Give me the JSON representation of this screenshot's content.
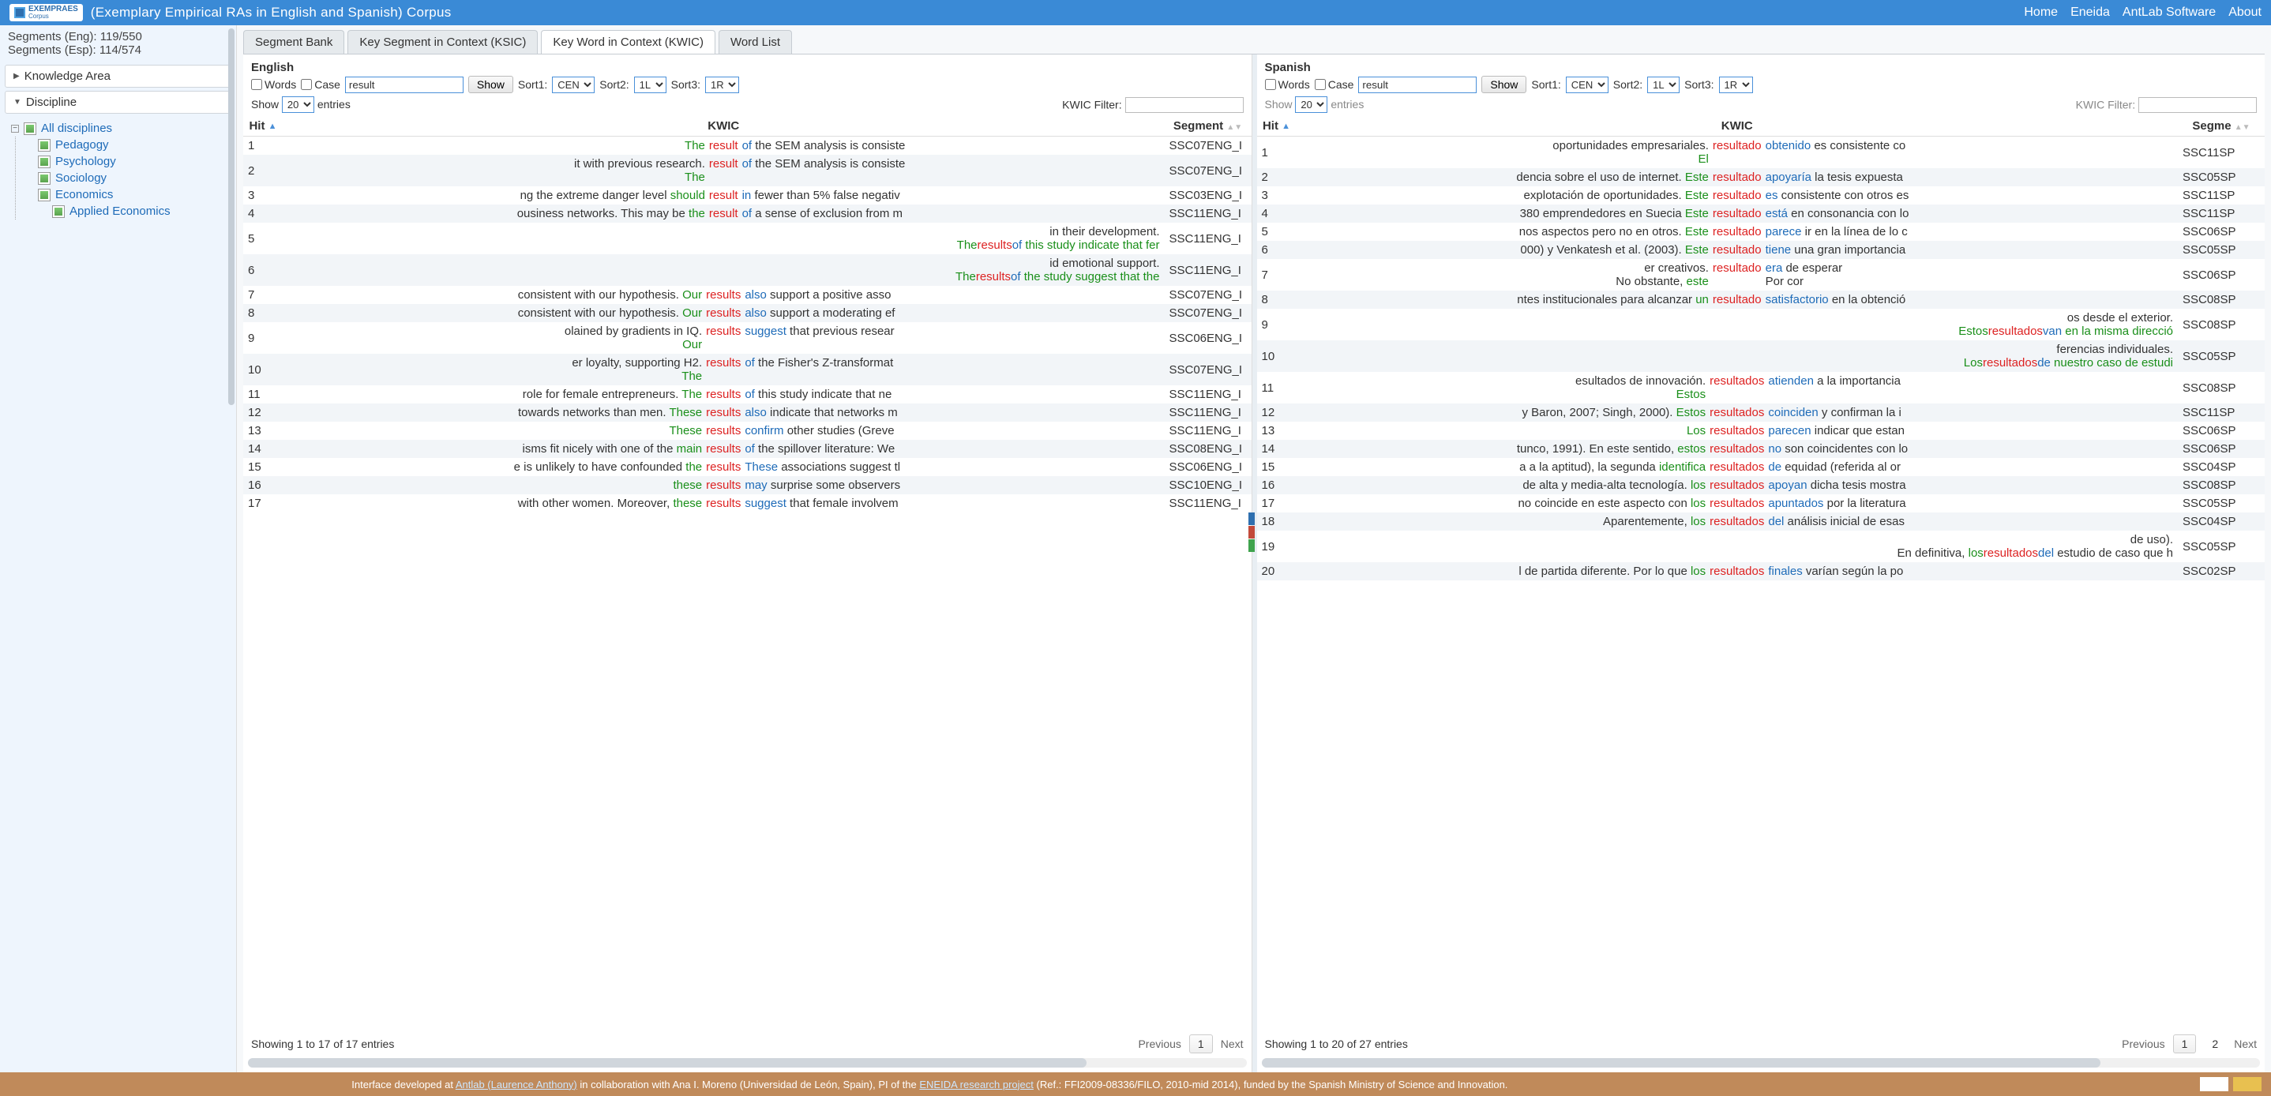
{
  "header": {
    "logo_text_top": "EXEMPRAES",
    "logo_text_bottom": "Corpus",
    "title": "(Exemplary Empirical RAs in English and Spanish) Corpus",
    "nav": {
      "home": "Home",
      "eneida": "Eneida",
      "antlab": "AntLab Software",
      "about": "About"
    }
  },
  "sidebar": {
    "seg_eng": "Segments (Eng): 119/550",
    "seg_esp": "Segments (Esp): 114/574",
    "knowledge_area": "Knowledge Area",
    "discipline": "Discipline",
    "all_disciplines": "All disciplines",
    "items": [
      "Pedagogy",
      "Psychology",
      "Sociology",
      "Economics",
      "Applied Economics"
    ]
  },
  "tabs": {
    "seg_bank": "Segment Bank",
    "ksic": "Key Segment in Context (KSIC)",
    "kwic": "Key Word in Context (KWIC)",
    "word_list": "Word List"
  },
  "controls": {
    "words": "Words",
    "case": "Case",
    "show_btn": "Show",
    "sort1": "Sort1:",
    "sort2": "Sort2:",
    "sort3": "Sort3:",
    "sort1_val": "CEN",
    "sort2_val": "1L",
    "sort3_val": "1R",
    "show_label": "Show",
    "entries": "entries",
    "kwic_filter": "KWIC Filter:",
    "entries_sel": "20"
  },
  "eng": {
    "title": "English",
    "search": "result",
    "cols": {
      "hit": "Hit",
      "kwic": "KWIC",
      "segment": "Segment"
    },
    "info": "Showing 1 to 17 of 17 entries",
    "prev": "Previous",
    "next": "Next",
    "page": "1",
    "rows": [
      {
        "n": 1,
        "L": "",
        "L1": "The",
        "C": "result",
        "R1": "of",
        "R": "the SEM analysis is consiste",
        "seg": "SSC07ENG_I"
      },
      {
        "n": 2,
        "L": "it with previous research.</p>",
        "L1": "The",
        "C": "result",
        "R1": "of",
        "R": "the SEM analysis is consiste",
        "seg": "SSC07ENG_I"
      },
      {
        "n": 3,
        "L": "ng the extreme danger level",
        "L1": "should",
        "C": "result",
        "R1": "in",
        "R": "fewer than 5% false negativ",
        "seg": "SSC03ENG_I"
      },
      {
        "n": 4,
        "L": "ousiness networks. This may be",
        "L1": "the",
        "C": "result",
        "R1": "of",
        "R": "a sense of exclusion from m",
        "seg": "SSC11ENG_I"
      },
      {
        "n": 5,
        "L": "in their development.</p>",
        "L1": "<p>The",
        "C": "results",
        "R1": "of",
        "R": "this study indicate that fer",
        "seg": "SSC11ENG_I"
      },
      {
        "n": 6,
        "L": "id emotional support.</p>",
        "L1": "<p>The",
        "C": "results",
        "R1": "of",
        "R": "the study suggest that the",
        "seg": "SSC11ENG_I"
      },
      {
        "n": 7,
        "L": "consistent with our hypothesis.",
        "L1": "Our",
        "C": "results",
        "R1": "also",
        "R": "support a positive asso",
        "seg": "SSC07ENG_I"
      },
      {
        "n": 8,
        "L": "consistent with our hypothesis.",
        "L1": "Our",
        "C": "results",
        "R1": "also",
        "R": "support a moderating ef",
        "seg": "SSC07ENG_I"
      },
      {
        "n": 9,
        "L": "olained by gradients in IQ.</p>",
        "L1": "Our",
        "C": "results",
        "R1": "suggest",
        "R": "that previous resear",
        "seg": "SSC06ENG_I"
      },
      {
        "n": 10,
        "L": "er loyalty, supporting H2.</p>",
        "L1": "The",
        "C": "results",
        "R1": "of",
        "R": "the Fisher's Z-transformat",
        "seg": "SSC07ENG_I"
      },
      {
        "n": 11,
        "L": "role for female entrepreneurs.",
        "L1": "The",
        "C": "results",
        "R1": "of",
        "R": "this study indicate that ne",
        "seg": "SSC11ENG_I"
      },
      {
        "n": 12,
        "L": "towards networks than men.",
        "L1": "These",
        "C": "results",
        "R1": "also",
        "R": "indicate that networks m",
        "seg": "SSC11ENG_I"
      },
      {
        "n": 13,
        "L": "",
        "L1": "These",
        "C": "results",
        "R1": "confirm",
        "R": "other studies (Greve",
        "seg": "SSC11ENG_I"
      },
      {
        "n": 14,
        "L": "isms fit nicely with one of the",
        "L1": "main",
        "C": "results",
        "R1": "of",
        "R": "the spillover literature: We",
        "seg": "SSC08ENG_I"
      },
      {
        "n": 15,
        "L": "e is unlikely to have confounded",
        "L1": "the",
        "C": "results",
        "R1": "These",
        "R": "associations suggest tl",
        "seg": "SSC06ENG_I"
      },
      {
        "n": 16,
        "L": "",
        "L1": "these",
        "C": "results",
        "R1": "may",
        "R": "surprise some observers",
        "seg": "SSC10ENG_I"
      },
      {
        "n": 17,
        "L": "with other women. Moreover,",
        "L1": "these",
        "C": "results",
        "R1": "suggest",
        "R": "that female involvem",
        "seg": "SSC11ENG_I"
      }
    ]
  },
  "esp": {
    "title": "Spanish",
    "search": "result",
    "cols": {
      "hit": "Hit",
      "kwic": "KWIC",
      "segment": "Segme"
    },
    "info": "Showing 1 to 20 of 27 entries",
    "prev": "Previous",
    "next": "Next",
    "page1": "1",
    "page2": "2",
    "rows": [
      {
        "n": 1,
        "L": "oportunidades empresariales.</p>",
        "L1": "El",
        "C": "resultado",
        "R1": "obtenido",
        "R": "es consistente co",
        "seg": "SSC11SP"
      },
      {
        "n": 2,
        "L": "dencia sobre el uso de internet.",
        "L1": "Este",
        "C": "resultado",
        "R1": "apoyaría",
        "R": "la tesis expuesta",
        "seg": "SSC05SP"
      },
      {
        "n": 3,
        "L": "explotación de oportunidades.",
        "L1": "Este",
        "C": "resultado",
        "R1": "es",
        "R": "consistente con otros es",
        "seg": "SSC11SP"
      },
      {
        "n": 4,
        "L": "380 emprendedores en Suecia",
        "L1": "Este",
        "C": "resultado",
        "R1": "está",
        "R": "en consonancia con lo",
        "seg": "SSC11SP"
      },
      {
        "n": 5,
        "L": "nos aspectos pero no en otros.",
        "L1": "Este",
        "C": "resultado",
        "R1": "parece",
        "R": "ir en la línea de lo c",
        "seg": "SSC06SP"
      },
      {
        "n": 6,
        "L": "000) y Venkatesh et al. (2003).",
        "L1": "Este",
        "C": "resultado",
        "R1": "tiene",
        "R": "una gran importancia",
        "seg": "SSC05SP"
      },
      {
        "n": 7,
        "L": "er creativos.</p> No obstante,",
        "L1": "este",
        "C": "resultado",
        "R1": "era",
        "R": "de esperar <p>Por cor",
        "seg": "SSC06SP"
      },
      {
        "n": 8,
        "L": "ntes institucionales para alcanzar",
        "L1": "un",
        "C": "resultado",
        "R1": "satisfactorio",
        "R": "en la obtenció",
        "seg": "SSC08SP"
      },
      {
        "n": 9,
        "L": "os desde el exterior.</p>",
        "L1": "<p>Estos",
        "C": "resultados",
        "R1": "van",
        "R": "en la misma direcció",
        "seg": "SSC08SP"
      },
      {
        "n": 10,
        "L": "ferencias individuales.</p>",
        "L1": "<p>Los",
        "C": "resultados",
        "R1": "de",
        "R": "nuestro caso de estudi",
        "seg": "SSC05SP"
      },
      {
        "n": 11,
        "L": "esultados de innovación.</p>",
        "L1": "Estos",
        "C": "resultados",
        "R1": "atienden",
        "R": "a la importancia",
        "seg": "SSC08SP"
      },
      {
        "n": 12,
        "L": "y Baron, 2007; Singh, 2000).",
        "L1": "Estos",
        "C": "resultados",
        "R1": "coinciden",
        "R": "y confirman la i",
        "seg": "SSC11SP"
      },
      {
        "n": 13,
        "L": "",
        "L1": "Los",
        "C": "resultados",
        "R1": "parecen",
        "R": "indicar que estan",
        "seg": "SSC06SP"
      },
      {
        "n": 14,
        "L": "tunco, 1991). En este sentido,",
        "L1": "estos",
        "C": "resultados",
        "R1": "no",
        "R": "son coincidentes con lo",
        "seg": "SSC06SP"
      },
      {
        "n": 15,
        "L": "a a la aptitud), la segunda",
        "L1": "identifica",
        "C": "resultados",
        "R1": "de",
        "R": "equidad (referida al or",
        "seg": "SSC04SP"
      },
      {
        "n": 16,
        "L": "de alta y media-alta tecnología.",
        "L1": "los",
        "C": "resultados",
        "R1": "apoyan",
        "R": "dicha tesis mostra",
        "seg": "SSC08SP"
      },
      {
        "n": 17,
        "L": "no coincide en este aspecto con",
        "L1": "los",
        "C": "resultados",
        "R1": "apuntados",
        "R": "por la literatura",
        "seg": "SSC05SP"
      },
      {
        "n": 18,
        "L": "Aparentemente,",
        "L1": "los",
        "C": "resultados",
        "R1": "del",
        "R": "análisis inicial de esas",
        "seg": "SSC04SP"
      },
      {
        "n": 19,
        "L": "de uso).</p> <p>En definitiva,",
        "L1": "los",
        "C": "resultados",
        "R1": "del",
        "R": "estudio de caso que h",
        "seg": "SSC05SP"
      },
      {
        "n": 20,
        "L": "l de partida diferente. Por lo que",
        "L1": "los",
        "C": "resultados",
        "R1": "finales",
        "R": "varían según la po",
        "seg": "SSC02SP"
      }
    ]
  },
  "footer": {
    "t1": "Interface developed at ",
    "l1": "Antlab (Laurence Anthony)",
    "t2": " in collaboration with Ana I. Moreno (Universidad de León, Spain), PI of the ",
    "l2": "ENEIDA research project",
    "t3": " (Ref.: FFI2009-08336/FILO, 2010-mid 2014), funded by the Spanish Ministry of Science and Innovation."
  }
}
